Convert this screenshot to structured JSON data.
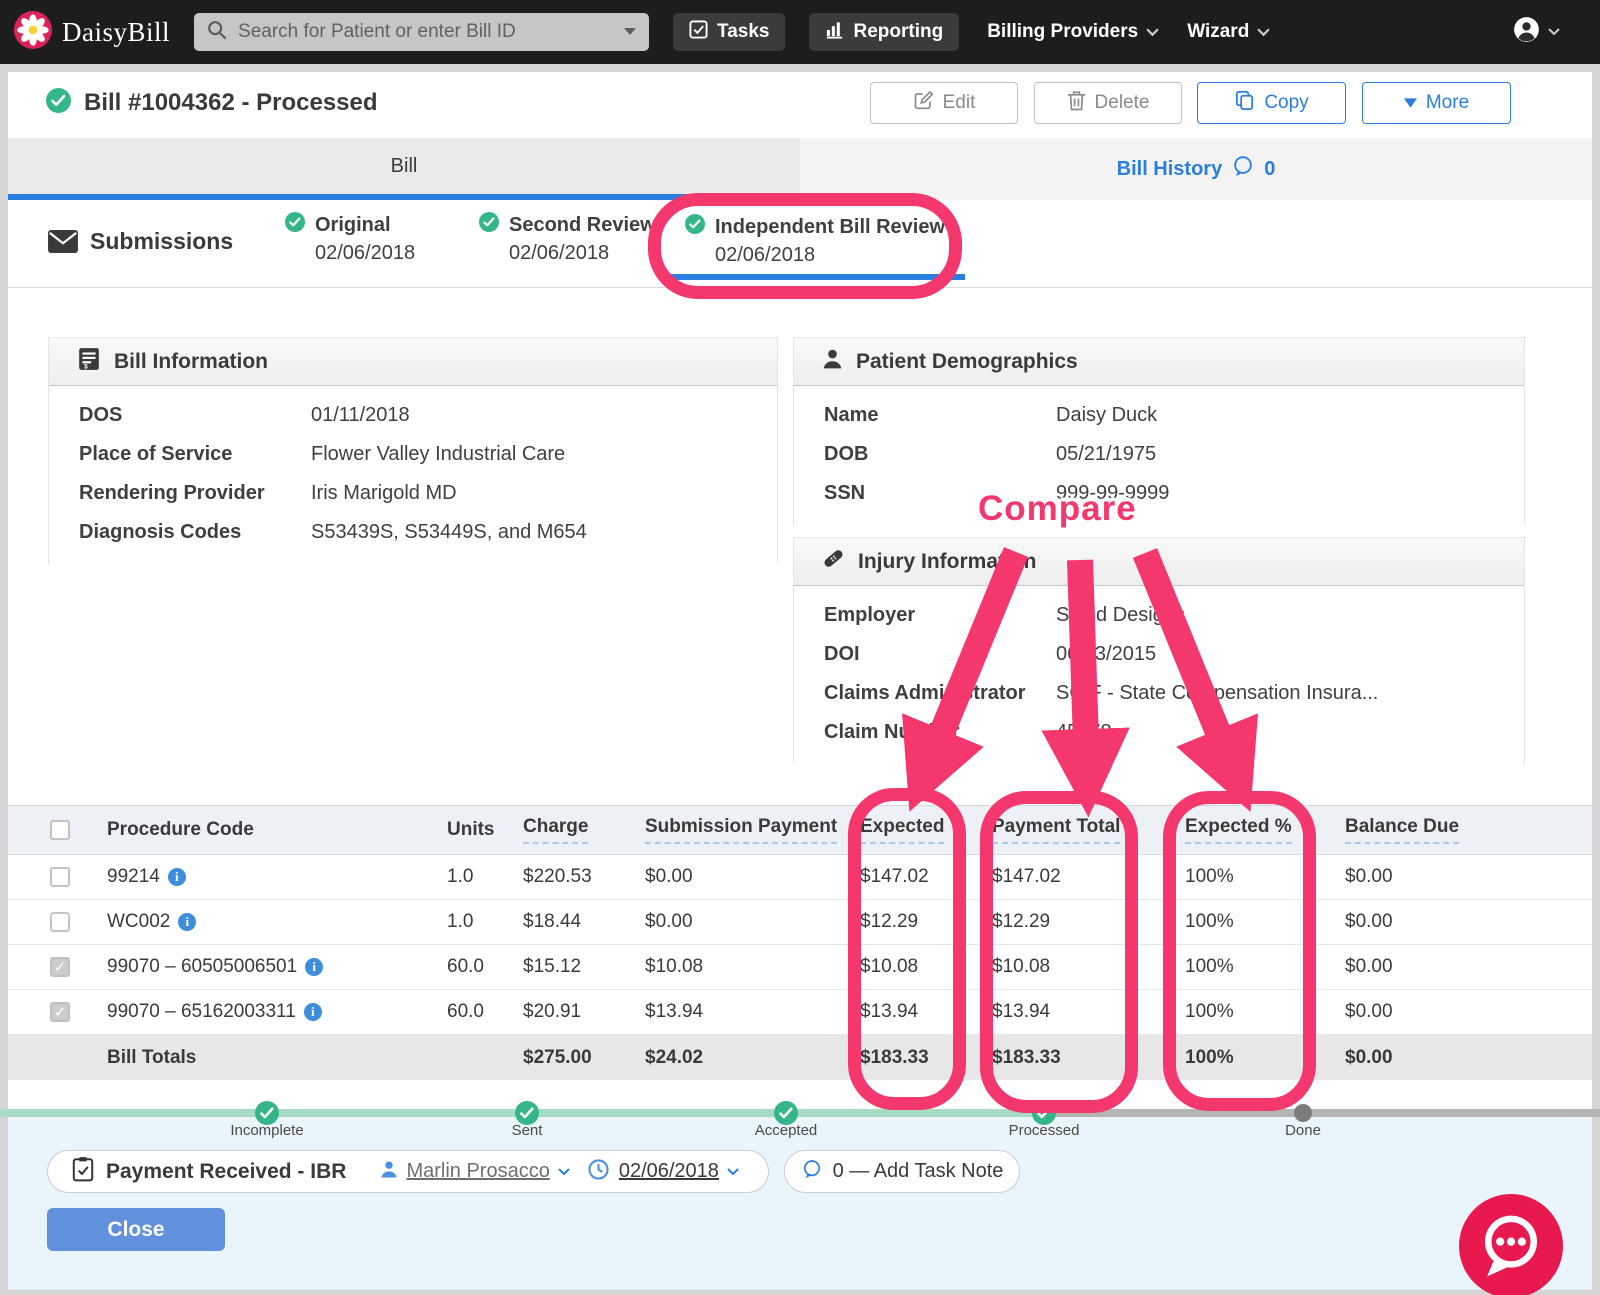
{
  "colors": {
    "accent": "#2a7ede",
    "green": "#35b688",
    "pink": "#f4376d",
    "nav": "#1d1d1d",
    "close_button": "#6191dc",
    "fab": "#e8194e"
  },
  "nav": {
    "brand": "DaisyBill",
    "search_placeholder": "Search for Patient or enter Bill ID",
    "tasks_label": "Tasks",
    "reporting_label": "Reporting",
    "billing_providers_label": "Billing Providers",
    "wizard_label": "Wizard"
  },
  "header": {
    "title": "Bill #1004362 - Processed",
    "edit_label": "Edit",
    "delete_label": "Delete",
    "copy_label": "Copy",
    "more_label": "More"
  },
  "tabs": {
    "bill_label": "Bill",
    "history_label": "Bill History",
    "history_count": "0"
  },
  "submissions": {
    "label": "Submissions",
    "items": [
      {
        "title": "Original",
        "date": "02/06/2018",
        "active": false
      },
      {
        "title": "Second Review",
        "date": "02/06/2018",
        "active": false
      },
      {
        "title": "Independent Bill Review",
        "date": "02/06/2018",
        "active": true
      }
    ]
  },
  "bill_information": {
    "title": "Bill Information",
    "rows": [
      {
        "label": "DOS",
        "value": "01/11/2018"
      },
      {
        "label": "Place of Service",
        "value": "Flower Valley Industrial Care"
      },
      {
        "label": "Rendering Provider",
        "value": "Iris Marigold MD"
      },
      {
        "label": "Diagnosis Codes",
        "value": "S53439S, S53449S, and M654"
      }
    ]
  },
  "patient_demographics": {
    "title": "Patient Demographics",
    "rows": [
      {
        "label": "Name",
        "value": "Daisy Duck"
      },
      {
        "label": "DOB",
        "value": "05/21/1975"
      },
      {
        "label": "SSN",
        "value": "999-99-9999"
      }
    ]
  },
  "injury_information": {
    "title": "Injury Information",
    "rows": [
      {
        "label": "Employer",
        "value": "Sapid Designs"
      },
      {
        "label": "DOI",
        "value": "06/23/2015"
      },
      {
        "label": "Claims Administrator",
        "value": "SCIF - State Compensation Insura..."
      },
      {
        "label": "Claim Number",
        "value": "45678"
      }
    ]
  },
  "annotation": {
    "compare_label": "Compare"
  },
  "table": {
    "headers": [
      "Procedure Code",
      "Units",
      "Charge",
      "Submission Payment",
      "Expected",
      "Payment Total",
      "Expected %",
      "Balance Due"
    ],
    "rows": [
      {
        "checked": false,
        "code": "99214",
        "units": "1.0",
        "charge": "$220.53",
        "submission_payment": "$0.00",
        "expected": "$147.02",
        "payment_total": "$147.02",
        "expected_pct": "100%",
        "balance_due": "$0.00"
      },
      {
        "checked": false,
        "code": "WC002",
        "units": "1.0",
        "charge": "$18.44",
        "submission_payment": "$0.00",
        "expected": "$12.29",
        "payment_total": "$12.29",
        "expected_pct": "100%",
        "balance_due": "$0.00"
      },
      {
        "checked": true,
        "code": "99070 – 60505006501",
        "units": "60.0",
        "charge": "$15.12",
        "submission_payment": "$10.08",
        "expected": "$10.08",
        "payment_total": "$10.08",
        "expected_pct": "100%",
        "balance_due": "$0.00"
      },
      {
        "checked": true,
        "code": "99070 – 65162003311",
        "units": "60.0",
        "charge": "$20.91",
        "submission_payment": "$13.94",
        "expected": "$13.94",
        "payment_total": "$13.94",
        "expected_pct": "100%",
        "balance_due": "$0.00"
      }
    ],
    "totals": {
      "label": "Bill Totals",
      "charge": "$275.00",
      "submission_payment": "$24.02",
      "expected": "$183.33",
      "payment_total": "$183.33",
      "expected_pct": "100%",
      "balance_due": "$0.00"
    }
  },
  "progress": {
    "steps": [
      {
        "label": "Incomplete",
        "state": "done"
      },
      {
        "label": "Sent",
        "state": "done"
      },
      {
        "label": "Accepted",
        "state": "done"
      },
      {
        "label": "Processed",
        "state": "done"
      },
      {
        "label": "Done",
        "state": "pending"
      }
    ]
  },
  "task": {
    "title": "Payment Received - IBR",
    "assignee": "Marlin Prosacco",
    "date": "02/06/2018",
    "note_label": "0 — Add Task Note"
  },
  "footer": {
    "close_label": "Close"
  }
}
